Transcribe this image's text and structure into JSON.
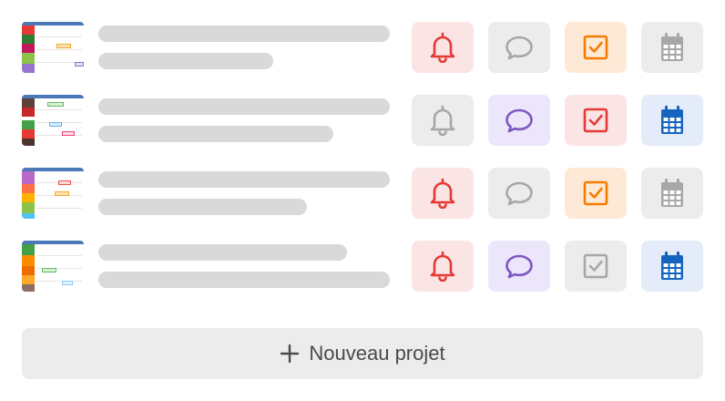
{
  "new_project": {
    "label": "Nouveau projet",
    "icon": "plus-icon"
  },
  "colors": {
    "skeleton": "#d9d9d9",
    "inactive_bg": "#ececec",
    "inactive_fg": "#a7a7a7",
    "bell_on_bg": "#fbe4e4",
    "bell_on_fg": "#e53935",
    "chat_on_bg": "#ebe6fa",
    "chat_on_fg": "#7e57c2",
    "task_orange_bg": "#fde9d6",
    "task_orange_fg": "#f57c00",
    "task_red_bg": "#fbe4e4",
    "task_red_fg": "#e53935",
    "cal_on_bg": "#e3ecf8",
    "cal_on_fg": "#1565c0"
  },
  "projects": [
    {
      "sidebar": [
        "#e53935",
        "#2e7d32",
        "#c2185b",
        "#8bc34a",
        "#9575cd"
      ],
      "notifications": "active",
      "comments": "inactive",
      "tasks": "orange",
      "calendar": "inactive"
    },
    {
      "sidebar": [
        "#5d4037",
        "#c62828",
        "#43a047",
        "#e53935",
        "#4e342e"
      ],
      "notifications": "inactive",
      "comments": "active",
      "tasks": "red",
      "calendar": "active"
    },
    {
      "sidebar": [
        "#ba68c8",
        "#ff7043",
        "#ffb300",
        "#8bc34a",
        "#4fc3f7"
      ],
      "notifications": "active",
      "comments": "inactive",
      "tasks": "orange",
      "calendar": "inactive"
    },
    {
      "sidebar": [
        "#43a047",
        "#fb8c00",
        "#ef6c00",
        "#ffa726",
        "#8d6e63"
      ],
      "notifications": "active",
      "comments": "active",
      "tasks": "inactive",
      "calendar": "active"
    }
  ]
}
